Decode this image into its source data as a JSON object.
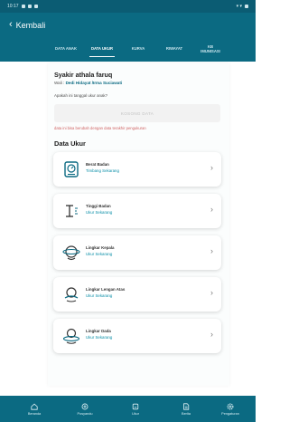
{
  "status_bar": {
    "time": "10:17",
    "signal_text": "▾ ▾"
  },
  "app_bar": {
    "back_icon": "chevron-left-icon",
    "title": "Kembali"
  },
  "tabs": [
    {
      "label": "DATA ANAK",
      "active": false
    },
    {
      "label": "DATA UKUR",
      "active": true
    },
    {
      "label": "KURVA",
      "active": false
    },
    {
      "label": "RIWAYAT",
      "active": false
    },
    {
      "label": "KB\nIMUNISASI",
      "active": false
    }
  ],
  "child": {
    "name": "Syakir athala faruq",
    "guardian_prefix": "Wali : ",
    "guardian_name": "Dedi Hidayat /Irma Suciawati"
  },
  "measure_date": {
    "question": "Apakah ini tanggal ukur anak?",
    "placeholder": "KOSONG DATA",
    "warning": "data ini bisa berubah dengan data terakhir pengukuran"
  },
  "section_title": "Data Ukur",
  "measurements": [
    {
      "title": "Berat Badan",
      "subtitle": "Timbang Sekarang",
      "icon": "weight-scale-icon"
    },
    {
      "title": "Tinggi Badan",
      "subtitle": "Ukur Sekarang",
      "icon": "height-ruler-icon"
    },
    {
      "title": "Lingkar Kepala",
      "subtitle": "Ukur Sekarang",
      "icon": "head-measure-icon"
    },
    {
      "title": "Lingkar Lengan Atas",
      "subtitle": "Ukur Sekarang",
      "icon": "arm-measure-icon"
    },
    {
      "title": "Lingkar Dada",
      "subtitle": "Ukur Sekarang",
      "icon": "chest-measure-icon"
    }
  ],
  "bottom_nav": [
    {
      "label": "Beranda",
      "icon": "home-icon"
    },
    {
      "label": "Posyandu",
      "icon": "posyandu-icon"
    },
    {
      "label": "Ukur",
      "icon": "measure-icon"
    },
    {
      "label": "Berita",
      "icon": "news-icon"
    },
    {
      "label": "Pengaturan",
      "icon": "settings-icon"
    }
  ],
  "colors": {
    "primary": "#0b6a82",
    "accent": "#0b8fa8",
    "warning": "#d06363",
    "chevron": "#7d7d7d"
  }
}
